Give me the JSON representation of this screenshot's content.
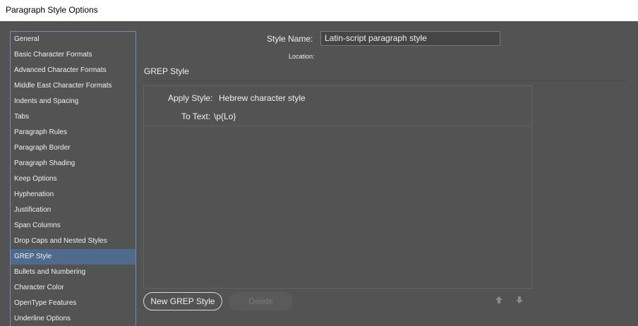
{
  "window": {
    "title": "Paragraph Style Options"
  },
  "sidebar": {
    "items": [
      {
        "label": "General"
      },
      {
        "label": "Basic Character Formats"
      },
      {
        "label": "Advanced Character Formats"
      },
      {
        "label": "Middle East Character Formats"
      },
      {
        "label": "Indents and Spacing"
      },
      {
        "label": "Tabs"
      },
      {
        "label": "Paragraph Rules"
      },
      {
        "label": "Paragraph Border"
      },
      {
        "label": "Paragraph Shading"
      },
      {
        "label": "Keep Options"
      },
      {
        "label": "Hyphenation"
      },
      {
        "label": "Justification"
      },
      {
        "label": "Span Columns"
      },
      {
        "label": "Drop Caps and Nested Styles"
      },
      {
        "label": "GREP Style"
      },
      {
        "label": "Bullets and Numbering"
      },
      {
        "label": "Character Color"
      },
      {
        "label": "OpenType Features"
      },
      {
        "label": "Underline Options"
      }
    ],
    "selected_label": "GREP Style"
  },
  "header": {
    "style_name_label": "Style Name:",
    "style_name_value": "Latin-script paragraph style",
    "location_label": "Location:"
  },
  "main": {
    "section_title": "GREP Style",
    "rule": {
      "apply_style_label": "Apply Style:",
      "apply_style_value": "Hebrew character style",
      "to_text_label": "To Text:",
      "to_text_value": "\\p{Lo}"
    },
    "buttons": {
      "new_label": "New GREP Style",
      "delete_label": "Delete"
    },
    "icons": {
      "move_up": "arrow-up-icon",
      "move_down": "arrow-down-icon"
    }
  },
  "colors": {
    "background": "#535353",
    "selection": "#4e6b8c",
    "sidebar_border": "#6d8fb3"
  }
}
